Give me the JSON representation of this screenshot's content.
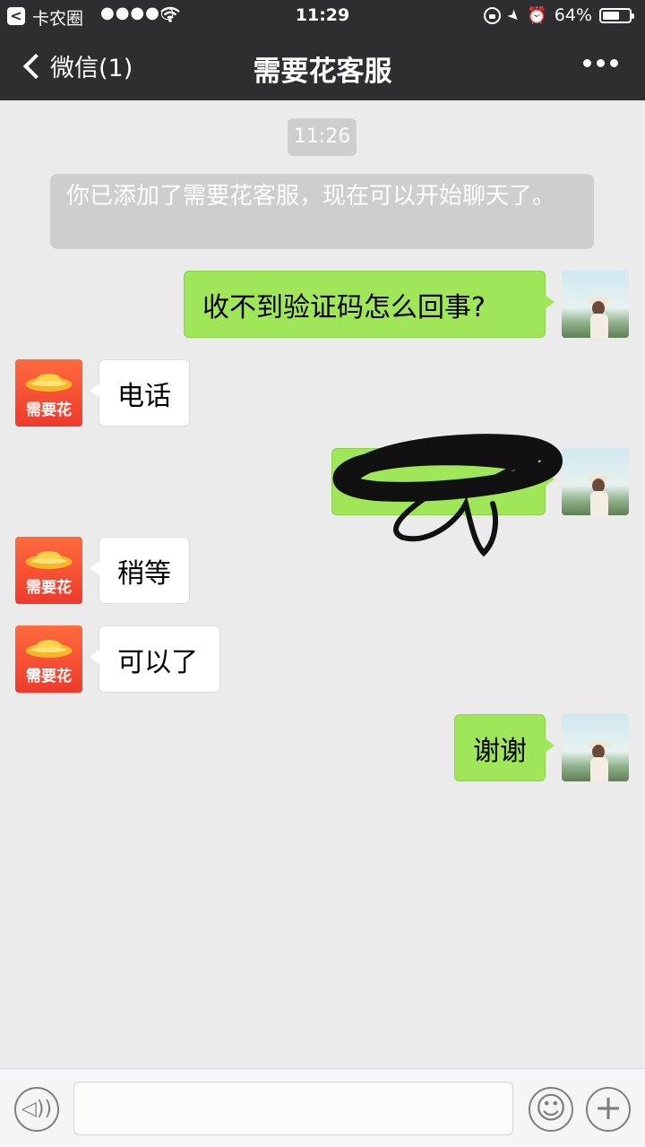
{
  "status_bar": {
    "back_app_label": "<",
    "carrier": "卡农圈",
    "signal": "●●●●○",
    "time": "11:29",
    "battery": "64%",
    "battery_level": 0.64
  },
  "nav": {
    "back_label": "微信(1)",
    "title": "需要花客服"
  },
  "chat": {
    "timestamp": "11:26",
    "system_notice": "你已添加了需要花客服，现在可以开始聊天了。",
    "messages": [
      {
        "side": "out",
        "text": "收不到验证码怎么回事?"
      },
      {
        "side": "in",
        "text": "电话"
      },
      {
        "side": "out",
        "text": ""
      },
      {
        "side": "in",
        "text": "稍等"
      },
      {
        "side": "in",
        "text": "可以了"
      },
      {
        "side": "out",
        "text": "谢谢"
      }
    ],
    "brand_avatar_text": "需要花"
  },
  "input_bar": {
    "placeholder": ""
  },
  "colors": {
    "nav_bg": "#2e2e30",
    "chat_bg": "#ebebeb",
    "outgoing_bubble": "#9fe658",
    "incoming_bubble": "#ffffff",
    "brand_avatar": "#ee3a2d"
  }
}
